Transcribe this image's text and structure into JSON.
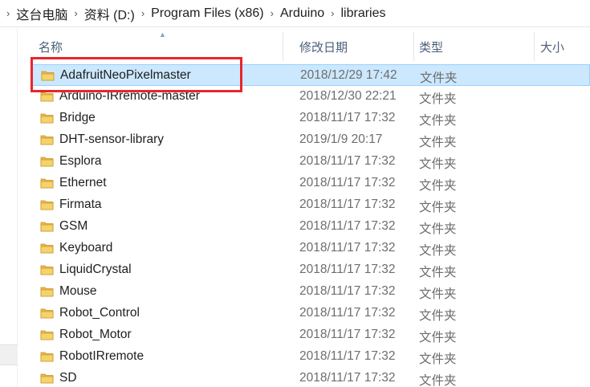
{
  "breadcrumb": {
    "separator": "›",
    "items": [
      "这台电脑",
      "资料 (D:)",
      "Program Files (x86)",
      "Arduino",
      "libraries"
    ]
  },
  "columns": {
    "name": "名称",
    "date": "修改日期",
    "type": "类型",
    "size": "大小"
  },
  "files": [
    {
      "name": "AdafruitNeoPixelmaster",
      "date": "2018/12/29 17:42",
      "type": "文件夹",
      "selected": true
    },
    {
      "name": "Arduino-IRremote-master",
      "date": "2018/12/30 22:21",
      "type": "文件夹"
    },
    {
      "name": "Bridge",
      "date": "2018/11/17 17:32",
      "type": "文件夹"
    },
    {
      "name": "DHT-sensor-library",
      "date": "2019/1/9 20:17",
      "type": "文件夹"
    },
    {
      "name": "Esplora",
      "date": "2018/11/17 17:32",
      "type": "文件夹"
    },
    {
      "name": "Ethernet",
      "date": "2018/11/17 17:32",
      "type": "文件夹"
    },
    {
      "name": "Firmata",
      "date": "2018/11/17 17:32",
      "type": "文件夹"
    },
    {
      "name": "GSM",
      "date": "2018/11/17 17:32",
      "type": "文件夹"
    },
    {
      "name": "Keyboard",
      "date": "2018/11/17 17:32",
      "type": "文件夹"
    },
    {
      "name": "LiquidCrystal",
      "date": "2018/11/17 17:32",
      "type": "文件夹"
    },
    {
      "name": "Mouse",
      "date": "2018/11/17 17:32",
      "type": "文件夹"
    },
    {
      "name": "Robot_Control",
      "date": "2018/11/17 17:32",
      "type": "文件夹"
    },
    {
      "name": "Robot_Motor",
      "date": "2018/11/17 17:32",
      "type": "文件夹"
    },
    {
      "name": "RobotIRremote",
      "date": "2018/11/17 17:32",
      "type": "文件夹"
    },
    {
      "name": "SD",
      "date": "2018/11/17 17:32",
      "type": "文件夹"
    }
  ],
  "colors": {
    "selection_bg": "#cce8ff",
    "selection_border": "#99d1ff",
    "annotation_box": "#e8262b",
    "folder_icon": "#e8b84a"
  },
  "icons": {
    "folder": "folder-icon",
    "sort": "sort-ascending-icon"
  }
}
